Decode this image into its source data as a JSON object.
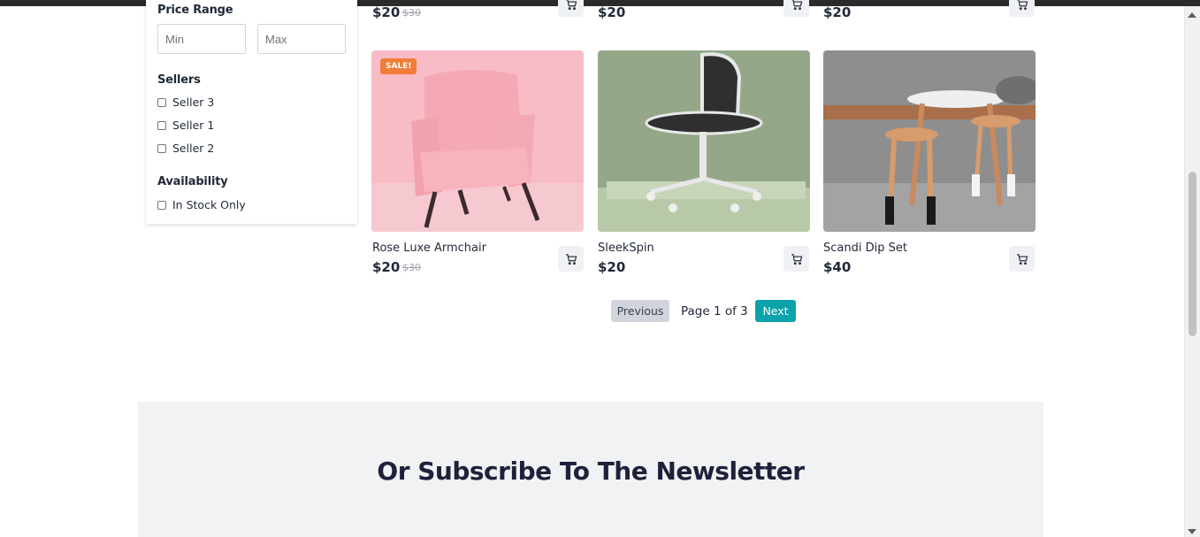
{
  "filters": {
    "price_range_heading": "Price Range",
    "min_placeholder": "Min",
    "max_placeholder": "Max",
    "sellers_heading": "Sellers",
    "sellers": [
      "Seller 3",
      "Seller 1",
      "Seller 2"
    ],
    "availability_heading": "Availability",
    "in_stock_label": "In Stock Only"
  },
  "top_row": [
    {
      "price": "$20",
      "old_price": "$30"
    },
    {
      "price": "$20"
    },
    {
      "price": "$20"
    }
  ],
  "products": [
    {
      "name": "Rose Luxe Armchair",
      "price": "$20",
      "old_price": "$30",
      "badge": "SALE!"
    },
    {
      "name": "SleekSpin",
      "price": "$20"
    },
    {
      "name": "Scandi Dip Set",
      "price": "$40"
    }
  ],
  "pagination": {
    "previous_label": "Previous",
    "page_info": "Page 1 of 3",
    "next_label": "Next"
  },
  "newsletter": {
    "title": "Or Subscribe To The Newsletter"
  },
  "colors": {
    "accent": "#0aa2ab",
    "sale_badge": "#f27c38",
    "newsletter_bg": "#f1f2f4"
  }
}
